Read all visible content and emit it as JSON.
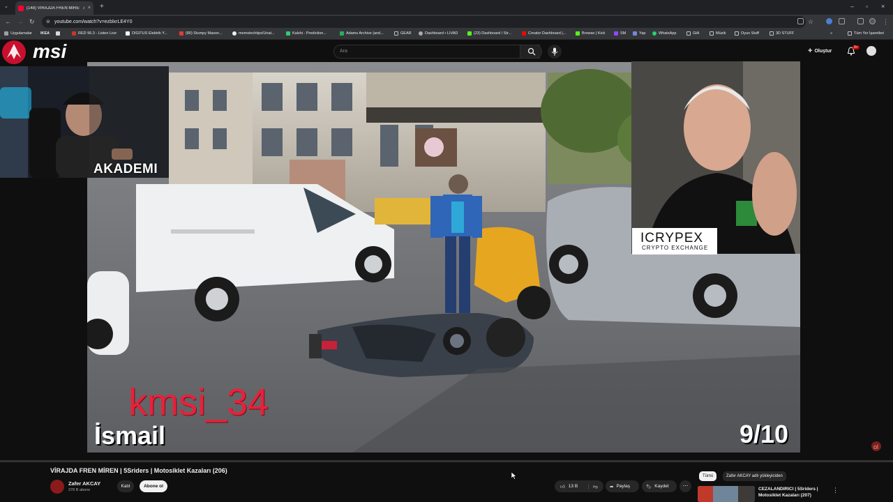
{
  "browser": {
    "tab_title": "(148) VİRAJDA FREN MİREN",
    "url": "youtube.com/watch?v=ezblxrLE4Y0",
    "bookmarks": [
      "Uygulamalar",
      "IKEA",
      "RED 96.3 - Listen Live",
      "DIGITUS Elektrik Y...",
      "(80) Stumpy Mason...",
      "memstechtips/Unat...",
      "Kalshi - Prediction...",
      "Adams Archive (and...",
      "GEAR",
      "Dashboard • LIVAD",
      "(23) Dashboard / Str...",
      "Creator Dashboard |...",
      "Browse | Kick",
      "SM",
      "Yap",
      "WhatsApp",
      "GtA",
      "Müzik",
      "Oyun Stuff",
      "3D STUFF"
    ],
    "all_bookmarks": "Tüm Yer İşaretleri"
  },
  "youtube_header": {
    "search_placeholder": "Ara",
    "create_label": "Oluştur",
    "notification_count": "9+"
  },
  "overlay": {
    "brand": "msi",
    "webcam_label": "AKADEMI",
    "sponsor_name": "ICRYPEX",
    "sponsor_tagline": "CRYPTO EXCHANGE",
    "rider_name": "kmsi_34",
    "submitter_name": "İsmail",
    "rating": "9/10"
  },
  "video": {
    "title": "VİRAJDA FREN MİREN | 5Sriders | Motosiklet Kazaları (206)",
    "channel_name": "Zafer AKCAY",
    "subscriber_count": "378 B abone",
    "join_label": "Katıl",
    "subscribe_label": "Abone ol",
    "like_count": "13 B",
    "share_label": "Paylaş",
    "save_label": "Kaydet",
    "progress_fraction": 0.0
  },
  "recommendations": {
    "chips": [
      "Tümü",
      "Zafer AKCAY adlı yükleyiciden"
    ],
    "items": [
      {
        "title": "CEZALANDIRICI | 5Sriders | Motosiklet Kazaları (207)"
      }
    ]
  },
  "colors": {
    "accent": "#ff0000",
    "overlay_red": "#e8213a",
    "background": "#0f0f0f"
  }
}
